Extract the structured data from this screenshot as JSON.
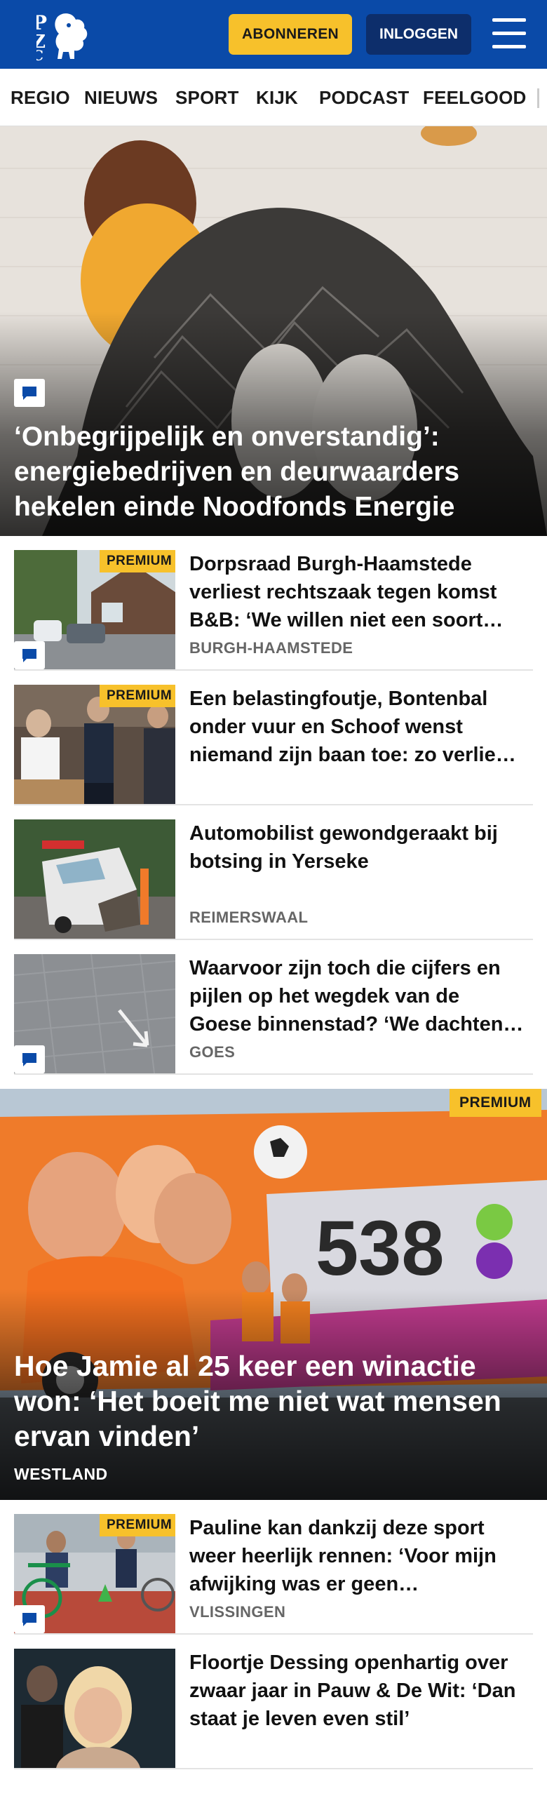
{
  "header": {
    "logo_text": "PZC",
    "subscribe_label": "ABONNEREN",
    "login_label": "INLOGGEN"
  },
  "nav": {
    "items": [
      "REGIO",
      "NIEUWS",
      "SPORT",
      "KIJK",
      "PODCAST",
      "FEELGOOD"
    ]
  },
  "hero": {
    "title": "‘Onbegrijpelijk en onverstandig’: energiebedrijven en deurwaarders hekelen einde Noodfonds Energie",
    "has_comments": true
  },
  "articles": [
    {
      "title": "Dorpsraad Burgh-Haamstede verliest rechtszaak tegen komst B&B: ‘We willen niet een soort…",
      "tag": "BURGH-HAAMSTEDE",
      "premium": "PREMIUM",
      "has_comments": true
    },
    {
      "title": "Een belastingfoutje, Bontenbal onder vuur en Schoof wenst niemand zijn baan toe: zo verlie…",
      "tag": "",
      "premium": "PREMIUM",
      "has_comments": false
    },
    {
      "title": "Automobilist gewondgeraakt bij botsing in Yerseke",
      "tag": "REIMERSWAAL",
      "premium": "",
      "has_comments": false
    },
    {
      "title": "Waarvoor zijn toch die cijfers en pijlen op het wegdek van de Goese binnenstad? ‘We dachten…",
      "tag": "GOES",
      "premium": "",
      "has_comments": true
    }
  ],
  "featured": {
    "title": "Hoe Jamie al 25 keer een winactie won: ‘Het boeit me niet wat mensen ervan vinden’",
    "tag": "WESTLAND",
    "premium": "PREMIUM",
    "image_text": "538"
  },
  "articles2": [
    {
      "title": "Pauline kan dankzij deze sport weer heerlijk rennen: ‘Voor mijn afwijking was er geen…",
      "tag": "VLISSINGEN",
      "premium": "PREMIUM",
      "has_comments": true
    },
    {
      "title": "Floortje Dessing openhartig over zwaar jaar in Pauw & De Wit: ‘Dan staat je leven even stil’",
      "tag": "",
      "premium": "",
      "has_comments": false
    }
  ],
  "colors": {
    "brand_blue": "#0a4aa8",
    "premium_yellow": "#f7c12b",
    "login_navy": "#0d2e6b"
  }
}
